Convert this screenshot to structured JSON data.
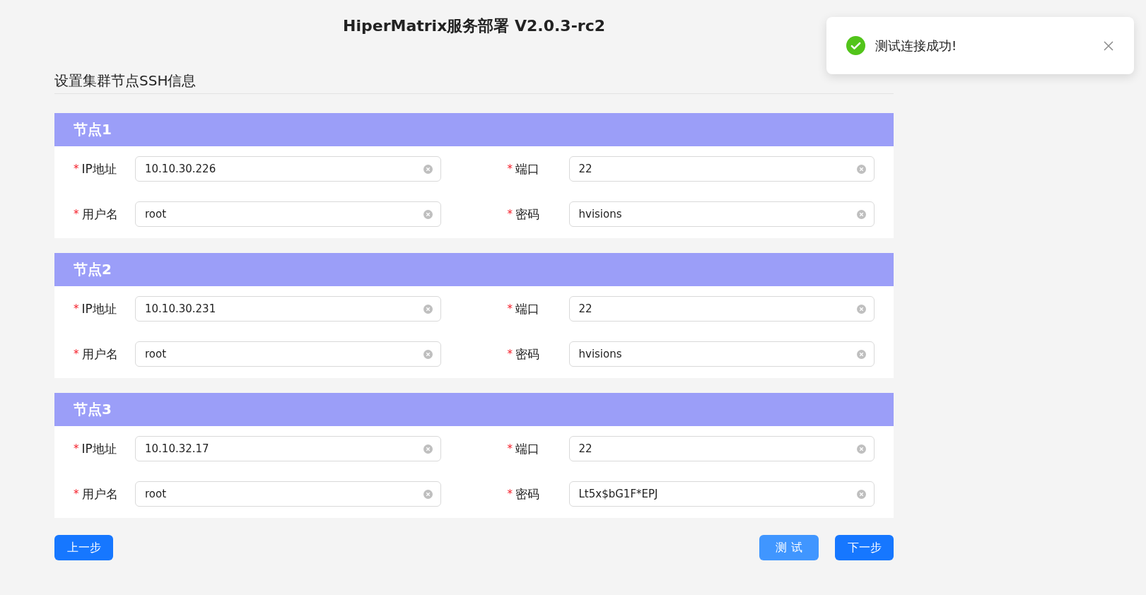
{
  "header": {
    "title": "HiperMatrix服务部署 V2.0.3-rc2"
  },
  "section": {
    "title": "设置集群节点SSH信息"
  },
  "nodes": [
    {
      "title": "节点1",
      "fields": [
        {
          "required_mark": "*",
          "label": "IP地址",
          "value": "10.10.30.226"
        },
        {
          "required_mark": "*",
          "label": "端口",
          "value": "22"
        },
        {
          "required_mark": "*",
          "label": "用户名",
          "value": "root"
        },
        {
          "required_mark": "*",
          "label": "密码",
          "value": "hvisions"
        }
      ]
    },
    {
      "title": "节点2",
      "fields": [
        {
          "required_mark": "*",
          "label": "IP地址",
          "value": "10.10.30.231"
        },
        {
          "required_mark": "*",
          "label": "端口",
          "value": "22"
        },
        {
          "required_mark": "*",
          "label": "用户名",
          "value": "root"
        },
        {
          "required_mark": "*",
          "label": "密码",
          "value": "hvisions"
        }
      ]
    },
    {
      "title": "节点3",
      "fields": [
        {
          "required_mark": "*",
          "label": "IP地址",
          "value": "10.10.32.17"
        },
        {
          "required_mark": "*",
          "label": "端口",
          "value": "22"
        },
        {
          "required_mark": "*",
          "label": "用户名",
          "value": "root"
        },
        {
          "required_mark": "*",
          "label": "密码",
          "value": "Lt5x$bG1F*EPJ"
        }
      ]
    }
  ],
  "buttons": {
    "left": [
      {
        "label": "上一步",
        "kind": "primary"
      }
    ],
    "right": [
      {
        "label": "测 试",
        "kind": "light"
      },
      {
        "label": "下一步",
        "kind": "primary"
      }
    ]
  },
  "toast": {
    "kind": "success",
    "message": "测试连接成功!"
  }
}
